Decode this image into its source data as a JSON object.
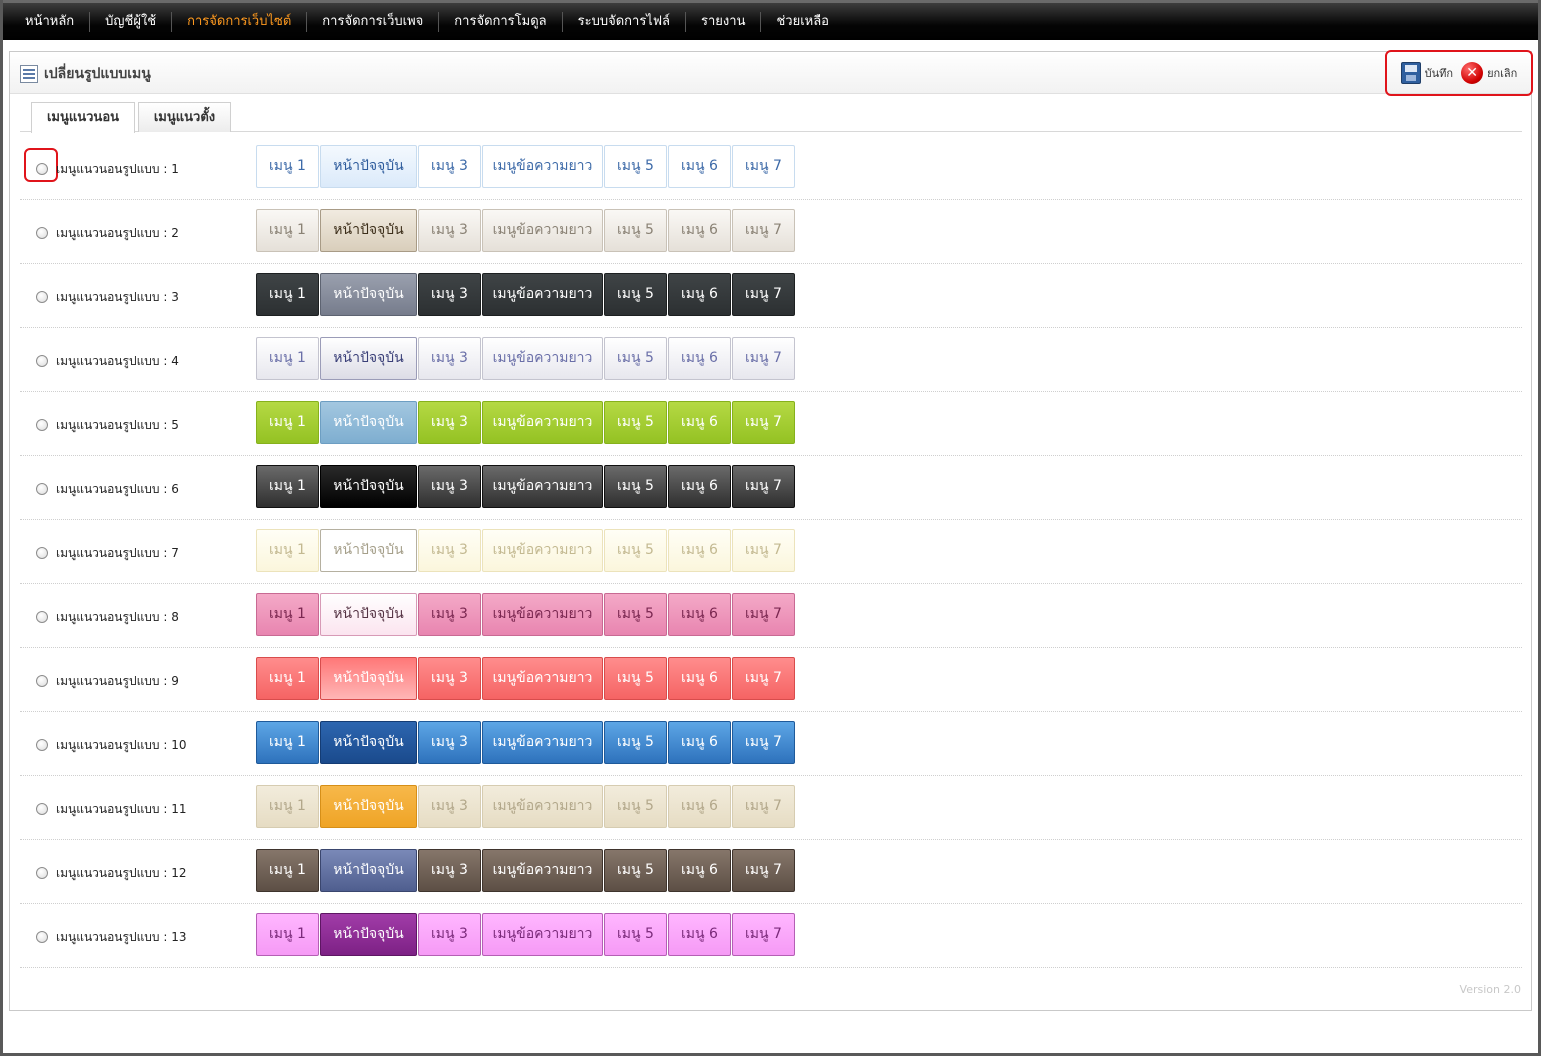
{
  "nav": {
    "items": [
      {
        "label": "หน้าหลัก",
        "active": false
      },
      {
        "label": "บัญชีผู้ใช้",
        "active": false
      },
      {
        "label": "การจัดการเว็บไซต์",
        "active": true
      },
      {
        "label": "การจัดการเว็บเพจ",
        "active": false
      },
      {
        "label": "การจัดการโมดูล",
        "active": false
      },
      {
        "label": "ระบบจัดการไฟล์",
        "active": false
      },
      {
        "label": "รายงาน",
        "active": false
      },
      {
        "label": "ช่วยเหลือ",
        "active": false
      }
    ]
  },
  "panel": {
    "title": "เปลี่ยนรูปแบบเมนู",
    "save_label": "บันทึก",
    "cancel_label": "ยกเลิก"
  },
  "tabs": [
    {
      "label": "เมนูแนวนอน",
      "active": true
    },
    {
      "label": "เมนูแนวตั้ง",
      "active": false
    }
  ],
  "menu_items": [
    "เมนู 1",
    "หน้าปัจจุบัน",
    "เมนู 3",
    "เมนูข้อความยาว",
    "เมนู 5",
    "เมนู 6",
    "เมนู 7"
  ],
  "rows": [
    {
      "label": "เมนูแนวนอนรูปแบบ : 1"
    },
    {
      "label": "เมนูแนวนอนรูปแบบ : 2"
    },
    {
      "label": "เมนูแนวนอนรูปแบบ : 3"
    },
    {
      "label": "เมนูแนวนอนรูปแบบ : 4"
    },
    {
      "label": "เมนูแนวนอนรูปแบบ : 5"
    },
    {
      "label": "เมนูแนวนอนรูปแบบ : 6"
    },
    {
      "label": "เมนูแนวนอนรูปแบบ : 7"
    },
    {
      "label": "เมนูแนวนอนรูปแบบ : 8"
    },
    {
      "label": "เมนูแนวนอนรูปแบบ : 9"
    },
    {
      "label": "เมนูแนวนอนรูปแบบ : 10"
    },
    {
      "label": "เมนูแนวนอนรูปแบบ : 11"
    },
    {
      "label": "เมนูแนวนอนรูปแบบ : 12"
    },
    {
      "label": "เมนูแนวนอนรูปแบบ : 13"
    }
  ],
  "footer": {
    "version": "Version 2.0"
  },
  "icons": {
    "panel": "menu-list-icon",
    "save": "floppy-disk-icon",
    "cancel": "close-circle-icon"
  },
  "colors": {
    "nav_active": "#ff9a1f",
    "highlight": "#e0141b"
  }
}
